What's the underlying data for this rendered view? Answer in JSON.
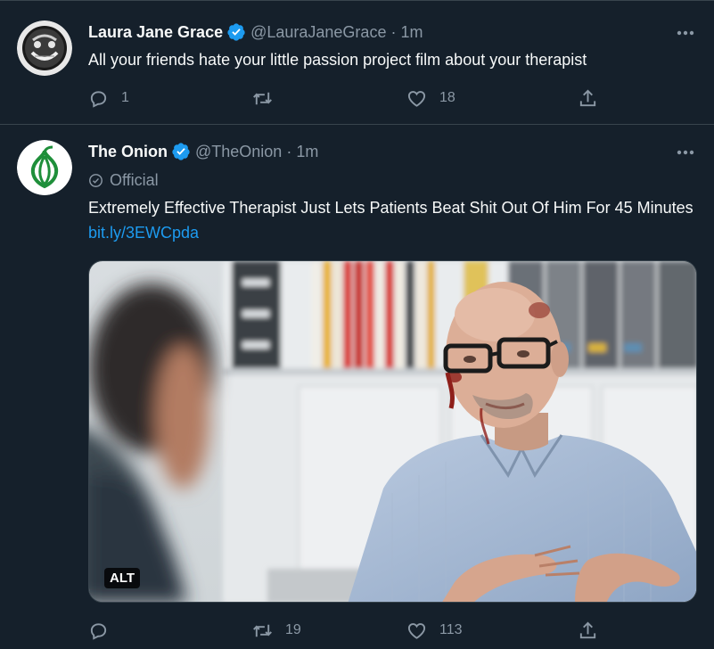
{
  "tweets": [
    {
      "author_name": "Laura Jane Grace",
      "handle": "@LauraJaneGrace",
      "time_sep": "·",
      "time": "1m",
      "text": "All your friends hate your little passion project film about your therapist",
      "reply_count": "1",
      "retweet_count": "",
      "like_count": "18"
    },
    {
      "author_name": "The Onion",
      "handle": "@TheOnion",
      "time_sep": "·",
      "time": "1m",
      "official_label": "Official",
      "text": "Extremely Effective Therapist Just Lets Patients Beat Shit Out Of Him For 45 Minutes ",
      "link": "bit.ly/3EWCpda",
      "alt_label": "ALT",
      "reply_count": "",
      "retweet_count": "19",
      "like_count": "113"
    }
  ],
  "colors": {
    "background": "#15202b",
    "divider": "#38444d",
    "primary_text": "#f7f9f9",
    "secondary_text": "#8b98a5",
    "link": "#1d9bf0",
    "verified": "#1d9bf0",
    "onion_green": "#1f8f3a"
  }
}
